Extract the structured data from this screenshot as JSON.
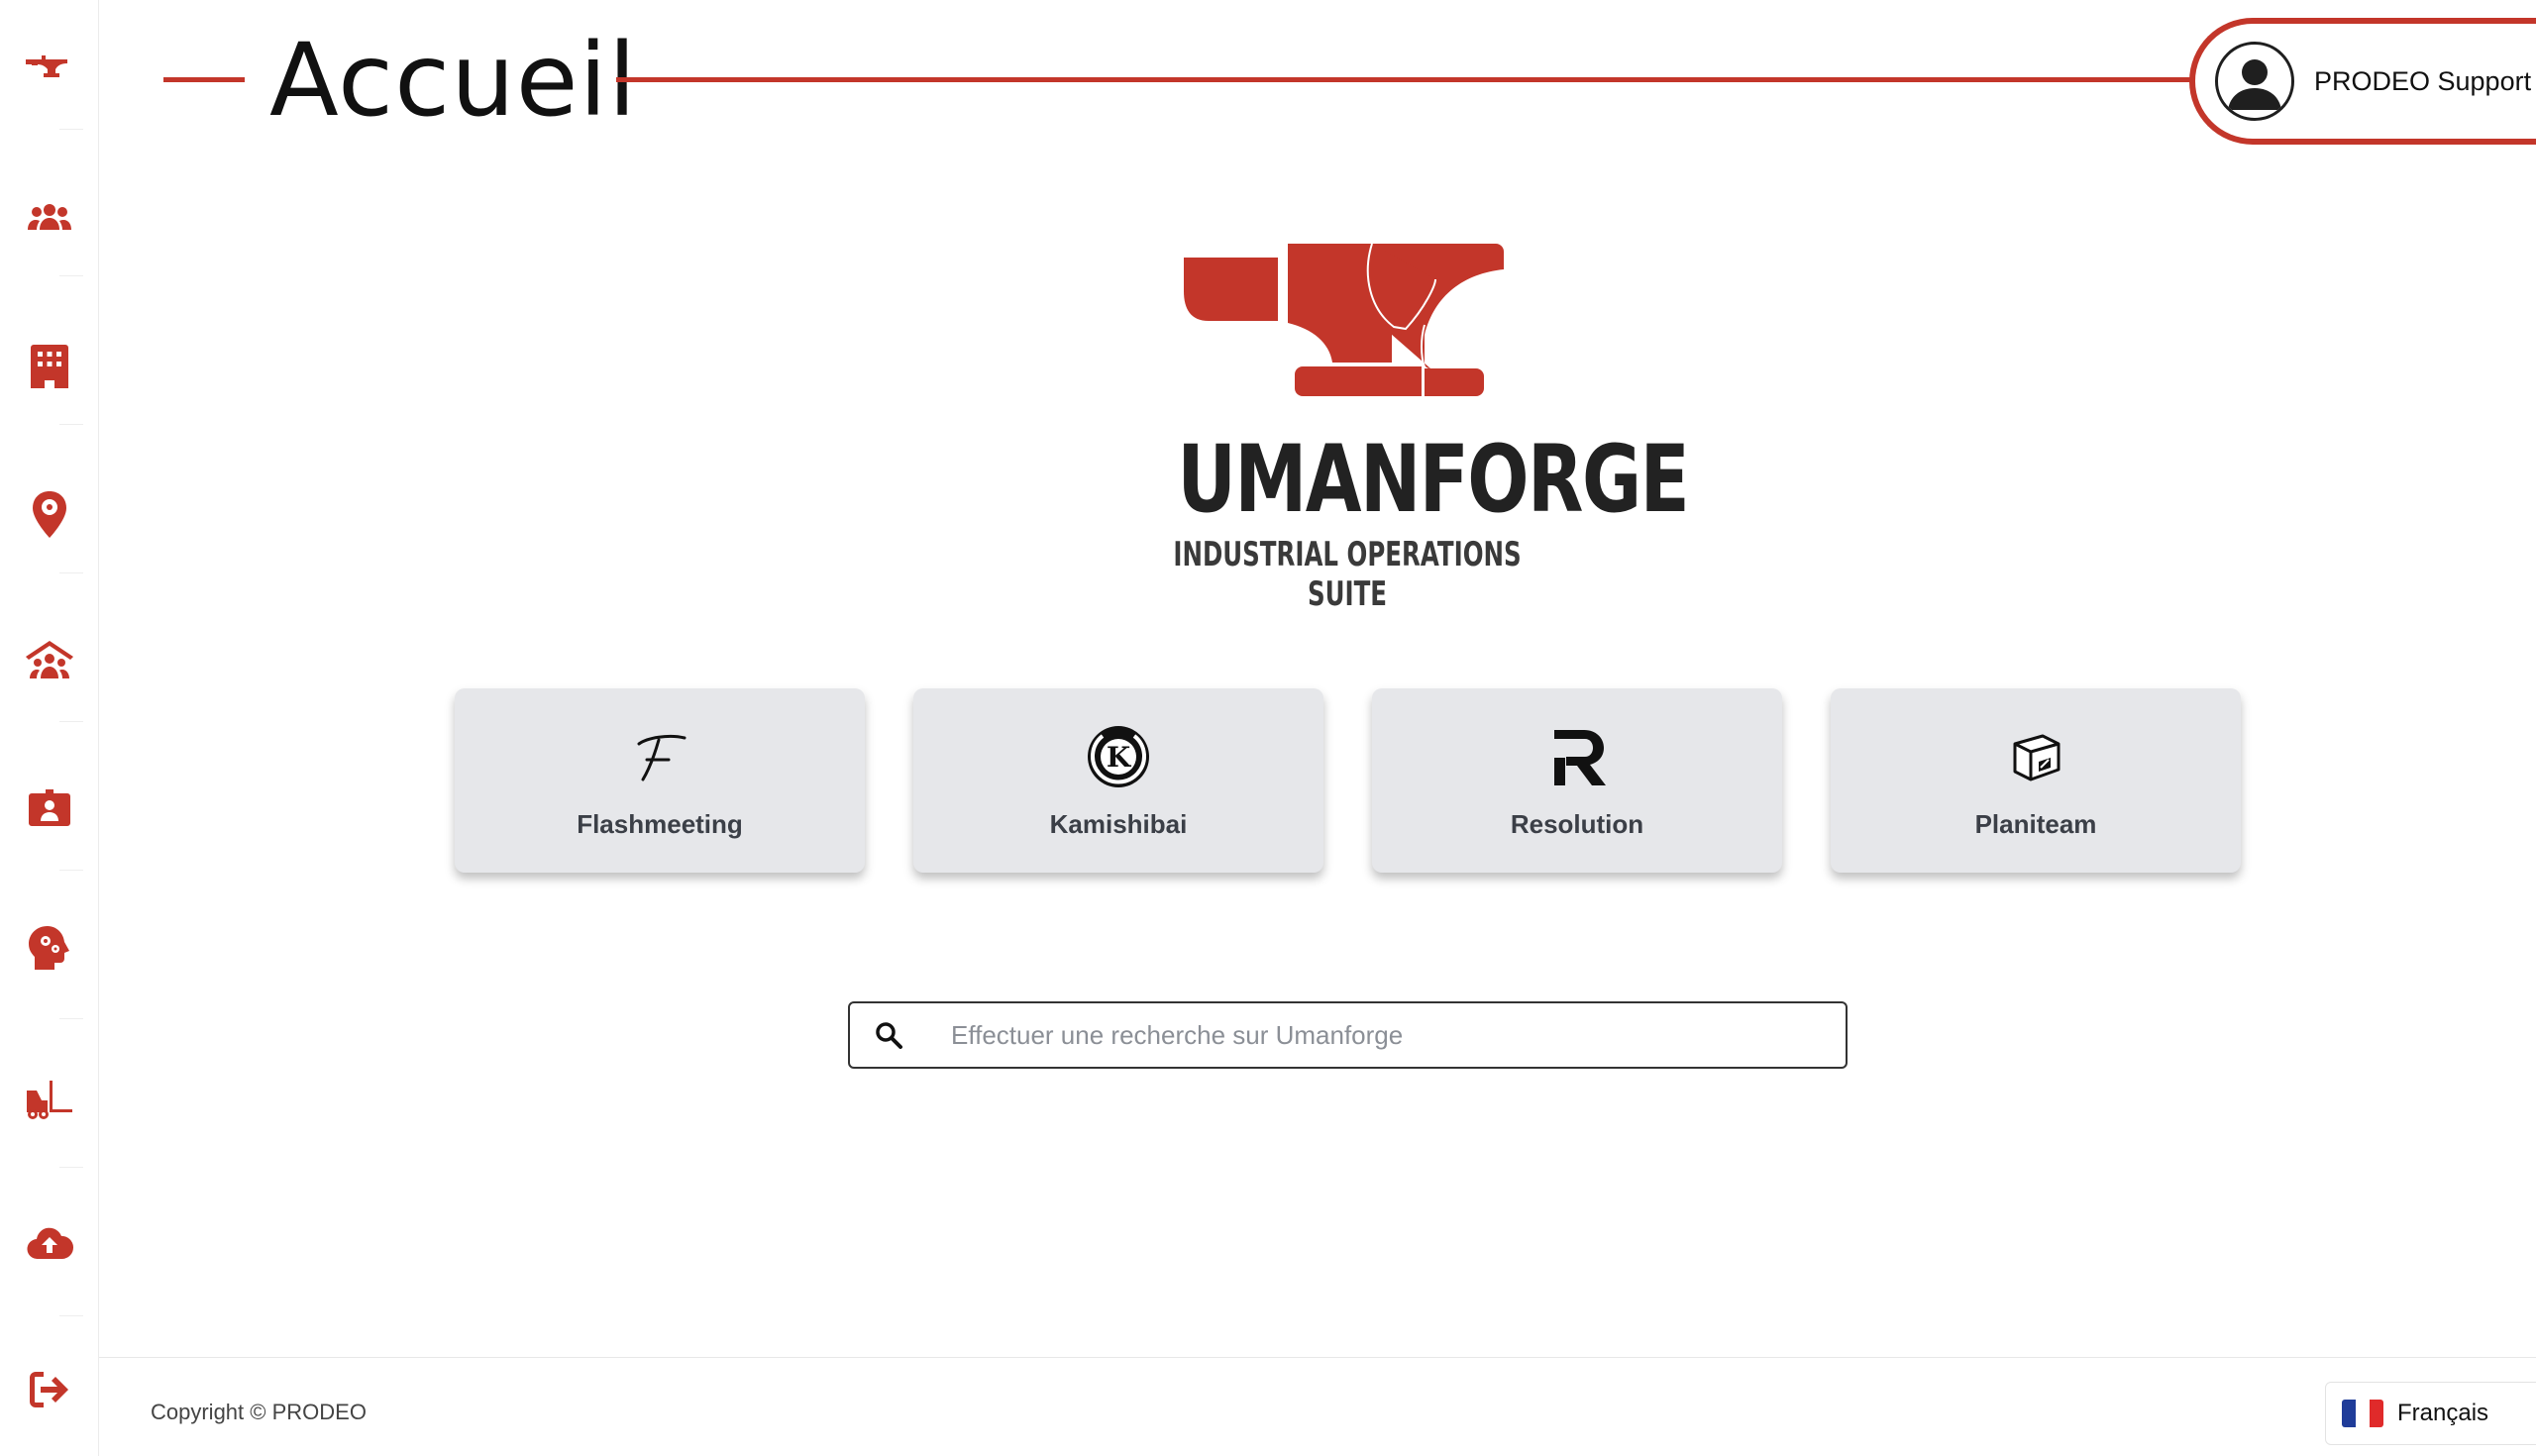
{
  "header": {
    "title": "Accueil",
    "user_name": "PRODEO Support"
  },
  "brand": {
    "name": "UMANFORGE",
    "tagline": "INDUSTRIAL OPERATIONS SUITE",
    "accent_color": "#c3362a"
  },
  "sidebar": {
    "items": [
      {
        "icon": "anvil-icon"
      },
      {
        "icon": "users-icon"
      },
      {
        "icon": "building-icon"
      },
      {
        "icon": "location-pin-icon"
      },
      {
        "icon": "team-roof-icon"
      },
      {
        "icon": "id-badge-icon"
      },
      {
        "icon": "head-gears-icon"
      },
      {
        "icon": "forklift-icon"
      },
      {
        "icon": "cloud-upload-icon"
      },
      {
        "icon": "logout-icon"
      }
    ]
  },
  "apps": [
    {
      "label": "Flashmeeting",
      "icon": "flashmeeting-icon"
    },
    {
      "label": "Kamishibai",
      "icon": "kamishibai-icon"
    },
    {
      "label": "Resolution",
      "icon": "resolution-icon"
    },
    {
      "label": "Planiteam",
      "icon": "planiteam-icon"
    }
  ],
  "search": {
    "placeholder": "Effectuer une recherche sur Umanforge"
  },
  "footer": {
    "copyright": "Copyright © PRODEO",
    "language": "Français"
  }
}
